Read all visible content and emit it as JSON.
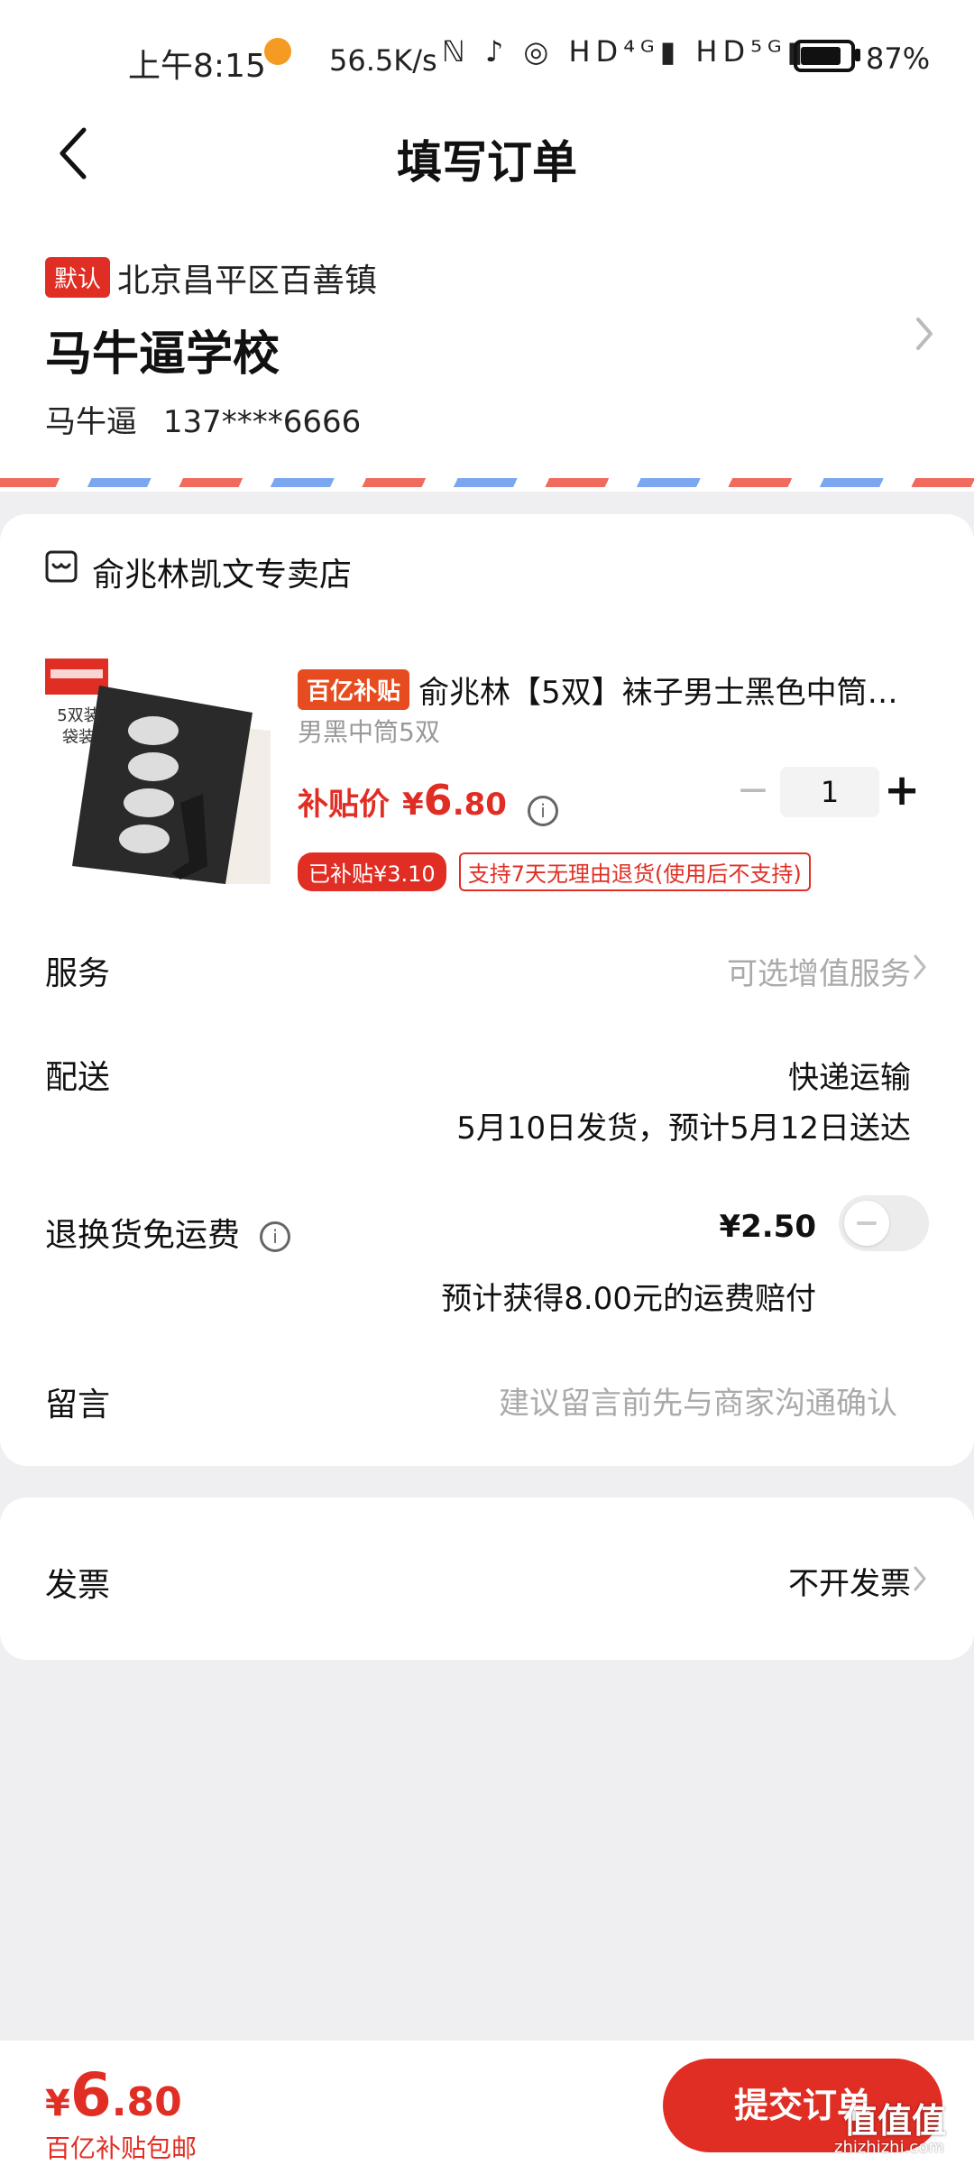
{
  "status_bar": {
    "time": "上午8:15",
    "network_speed": "56.5K/s",
    "icons": [
      "nfc-icon",
      "mute-icon",
      "alarm-icon",
      "hd-icon",
      "signal-4g-icon",
      "hd-icon",
      "signal-5g-icon"
    ],
    "signal_text": "ℕ ♪ ◎ HD⁴ᴳ▮ HD⁵ᴳ▮",
    "battery": "87%"
  },
  "header": {
    "title": "填写订单"
  },
  "address": {
    "badge": "默认",
    "region": "北京昌平区百善镇",
    "name": "马牛逼学校",
    "contact_name": "马牛逼",
    "phone": "137****6666"
  },
  "shop": {
    "name": "俞兆林凯文专卖店"
  },
  "product": {
    "image_text": "5双装 袋装",
    "tag": "百亿补贴",
    "title": "俞兆林【5双】袜子男士黑色中筒…",
    "spec": "男黑中筒5双",
    "price_label": "补贴价",
    "price_currency": "¥",
    "price_int": "6",
    "price_dec": ".80",
    "quantity": "1",
    "subsidy_tag": "已补贴¥3.10",
    "return_tag": "支持7天无理由退货(使用后不支持)"
  },
  "rows": {
    "service_label": "服务",
    "service_value": "可选增值服务",
    "delivery_label": "配送",
    "delivery_value": "快递运输",
    "delivery_note": "5月10日发货，预计5月12日送达",
    "freight_label": "退换货免运费",
    "freight_price": "¥2.50",
    "freight_note": "预计获得8.00元的运费赔付",
    "message_label": "留言",
    "message_placeholder": "建议留言前先与商家沟通确认"
  },
  "invoice": {
    "label": "发票",
    "value": "不开发票"
  },
  "footer": {
    "currency": "¥",
    "total_int": "6",
    "total_dec": ".80",
    "note": "百亿补贴包邮",
    "submit_label": "提交订单"
  },
  "watermark": {
    "text": "值值值",
    "sub": "zhizhizhi.com"
  },
  "colors": {
    "accent": "#e02e24",
    "page_bg": "#efeff1",
    "muted": "#aaaaaa"
  }
}
